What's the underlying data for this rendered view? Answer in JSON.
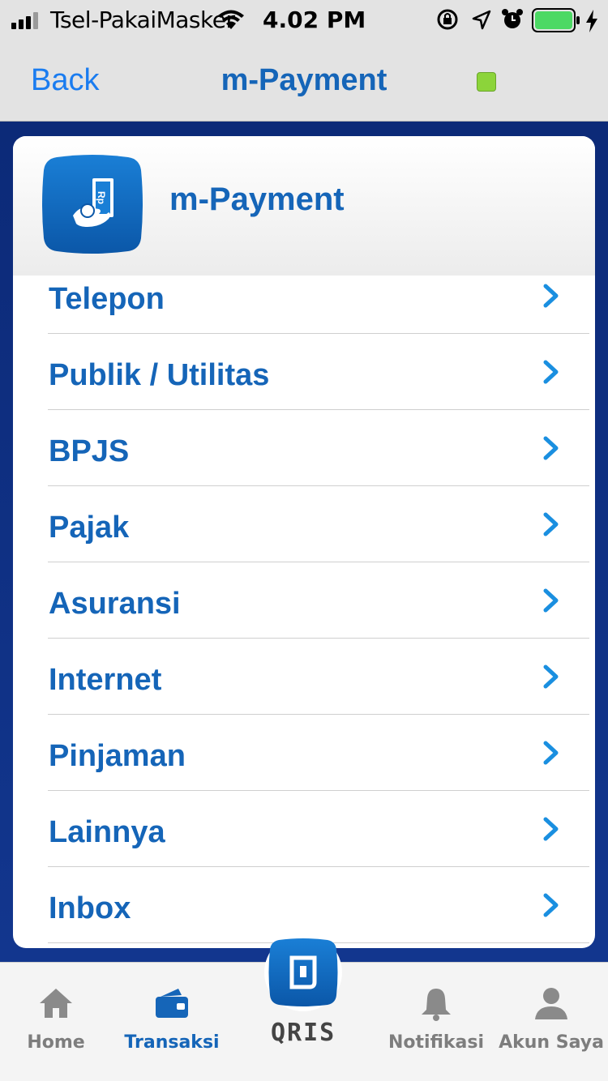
{
  "status_bar": {
    "carrier": "Tsel-PakaiMasker",
    "time": "4.02 PM",
    "icons": [
      "signal-icon",
      "wifi-icon",
      "rotation-lock-icon",
      "location-icon",
      "alarm-icon",
      "battery-icon",
      "charging-icon"
    ],
    "battery_color": "#4cd964"
  },
  "navbar": {
    "back_label": "Back",
    "title": "m-Payment",
    "indicator_color": "#8cd43a"
  },
  "card": {
    "title": "m-Payment",
    "icon": "payment-hand-rp-icon",
    "items": [
      {
        "label": "Telepon"
      },
      {
        "label": "Publik / Utilitas"
      },
      {
        "label": "BPJS"
      },
      {
        "label": "Pajak"
      },
      {
        "label": "Asuransi"
      },
      {
        "label": "Internet"
      },
      {
        "label": "Pinjaman"
      },
      {
        "label": "Lainnya"
      },
      {
        "label": "Inbox"
      }
    ]
  },
  "tabbar": {
    "home": "Home",
    "transaksi": "Transaksi",
    "qris": "QRIS",
    "notifikasi": "Notifikasi",
    "akun": "Akun Saya",
    "active": "transaksi",
    "active_color": "#1565b8"
  },
  "colors": {
    "primary": "#1565b8",
    "background": "#0c2a78",
    "link": "#1a7cf0"
  }
}
